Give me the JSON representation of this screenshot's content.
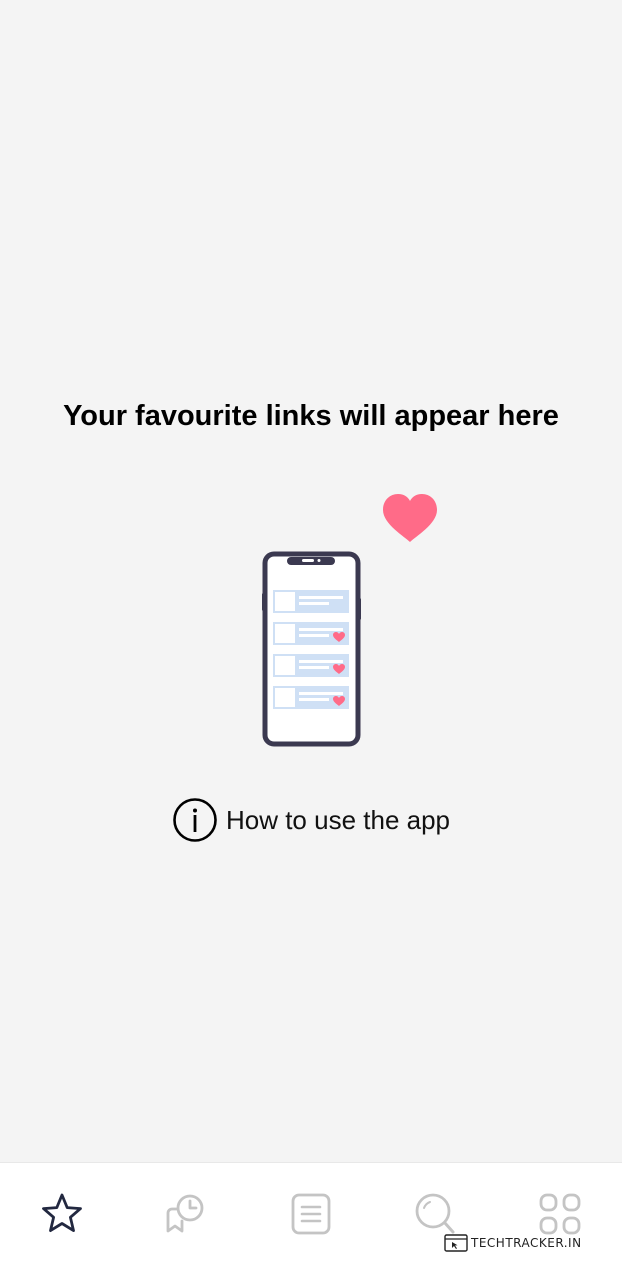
{
  "empty_state": {
    "title": "Your favourite links will appear here",
    "help_link_label": "How to use the app",
    "illustration_icon": "phone-with-favourite-links-illustration",
    "heart_color": "#ff6b88",
    "phone_frame_color": "#3b3950",
    "list_row_color": "#cfe0f5"
  },
  "bottom_nav": {
    "active_color": "#222840",
    "inactive_color": "#c4c4c4",
    "items": [
      {
        "icon": "star-icon",
        "active": true
      },
      {
        "icon": "history-clock-icon",
        "active": false
      },
      {
        "icon": "list-document-icon",
        "active": false
      },
      {
        "icon": "search-icon",
        "active": false
      },
      {
        "icon": "grid-apps-icon",
        "active": false
      }
    ]
  },
  "watermark": {
    "text": "TechTracker.in"
  }
}
